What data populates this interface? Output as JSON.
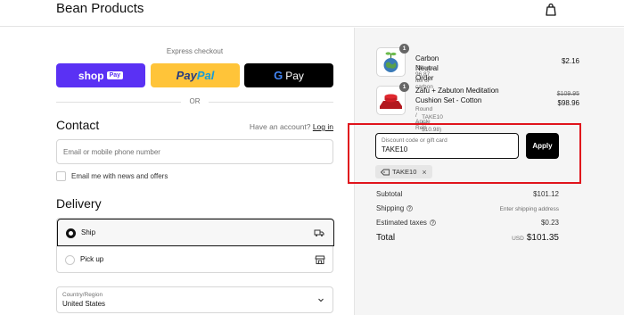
{
  "header": {
    "store_name": "Bean Products"
  },
  "express": {
    "title": "Express checkout",
    "shoppay_text": "shop",
    "shoppay_badge": "Pay",
    "paypal_part1": "Pay",
    "paypal_part2": "Pal",
    "gpay_g": "G",
    "gpay_text": "Pay",
    "or_text": "OR"
  },
  "contact": {
    "title": "Contact",
    "have_account": "Have an account?",
    "login_link": "Log in",
    "email_placeholder": "Email or mobile phone number",
    "news_label": "Email me with news and offers"
  },
  "delivery": {
    "title": "Delivery",
    "options": [
      {
        "label": "Ship",
        "selected": true,
        "icon": "truck-icon"
      },
      {
        "label": "Pick up",
        "selected": false,
        "icon": "store-icon"
      }
    ],
    "country_label": "Country/Region",
    "country_value": "United States"
  },
  "order": {
    "items": [
      {
        "name": "Carbon Neutral Order",
        "sub": "Offsets 96.87 lbs of carbon",
        "qty": "1",
        "price": "$2.16"
      },
      {
        "name": "Zafu + Zabuton Meditation Cushion Set - Cotton",
        "variant": "Round / Apple Red",
        "discount_tag": "TAKE10 (−$10.98)",
        "qty": "1",
        "compare_price": "$109.95",
        "price": "$98.96"
      }
    ],
    "discount": {
      "label": "Discount code or gift card",
      "value": "TAKE10",
      "apply_label": "Apply",
      "applied_code": "TAKE10"
    },
    "summary": {
      "subtotal_label": "Subtotal",
      "subtotal_value": "$101.12",
      "shipping_label": "Shipping",
      "shipping_value": "Enter shipping address",
      "taxes_label": "Estimated taxes",
      "taxes_value": "$0.23",
      "total_label": "Total",
      "total_currency": "USD",
      "total_value": "$101.35"
    }
  },
  "colors": {
    "shoppay": "#5a31f4",
    "paypal": "#ffc439",
    "highlight": "#e0141c"
  }
}
